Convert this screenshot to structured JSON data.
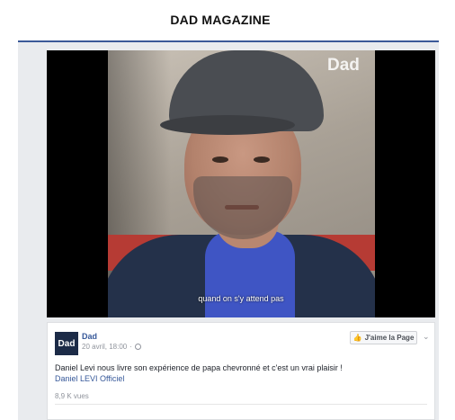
{
  "header": {
    "title": "DAD MAGAZINE"
  },
  "video": {
    "watermark": "Dad",
    "subtitle": "quand on s'y attend pas"
  },
  "post": {
    "logo_text": "Dad",
    "page_name": "Dad",
    "date": "20 avril, 18:00",
    "separator": "·",
    "like_page_label": "J'aime la Page",
    "text": "Daniel Levi nous livre son expérience de papa chevronné et c'est un vrai plaisir !",
    "link": "Daniel LEVI Officiel",
    "views": "8,9 K vues"
  },
  "colors": {
    "brand_blue": "#3b5998",
    "link_blue": "#365899",
    "background": "#e9ebee"
  },
  "icons": {
    "like": "thumbs-up-icon",
    "privacy": "globe-icon",
    "menu": "chevron-down-icon"
  }
}
